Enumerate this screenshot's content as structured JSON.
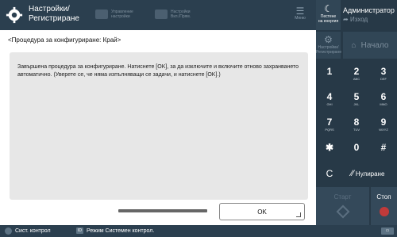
{
  "header": {
    "title_line1": "Настройки/",
    "title_line2": "Регистриране",
    "shortcut1_line1": "Управление",
    "shortcut1_line2": "настройки",
    "shortcut2_line1": "Настройки",
    "shortcut2_line2": "Вкл./Прям.",
    "menu_label": "Меню"
  },
  "right_panel": {
    "energy_line1": "Пестене",
    "energy_line2": "на енергия",
    "user": "Администратор",
    "logout": "Изход",
    "settings_line1": "Настройки/",
    "settings_line2": "Регистриране",
    "home": "Начало",
    "keys": [
      {
        "d": "1",
        "s": ""
      },
      {
        "d": "2",
        "s": "ABC"
      },
      {
        "d": "3",
        "s": "DEF"
      },
      {
        "d": "4",
        "s": "GHI"
      },
      {
        "d": "5",
        "s": "JKL"
      },
      {
        "d": "6",
        "s": "MNO"
      },
      {
        "d": "7",
        "s": "PQRS"
      },
      {
        "d": "8",
        "s": "TUV"
      },
      {
        "d": "9",
        "s": "WXYZ"
      },
      {
        "d": "✱",
        "s": ""
      },
      {
        "d": "0",
        "s": ""
      },
      {
        "d": "#",
        "s": ""
      }
    ],
    "clear_key": "C",
    "reset": "Нулиране",
    "start": "Старт",
    "stop": "Стоп"
  },
  "main": {
    "heading": "<Процедура за конфигуриране: Край>",
    "message": "Завършена процедура за конфигуриране. Натиснете [OK], за да изключите и включите отново захранването автоматично. (Уверете се, че няма изпълняващи се задачи, и натиснете [OK].)",
    "ok_label": "OK"
  },
  "status_bar": {
    "monitor_label": "Сист. контрол",
    "id_badge": "ID",
    "mode_text": "Режим Системен контрол."
  }
}
